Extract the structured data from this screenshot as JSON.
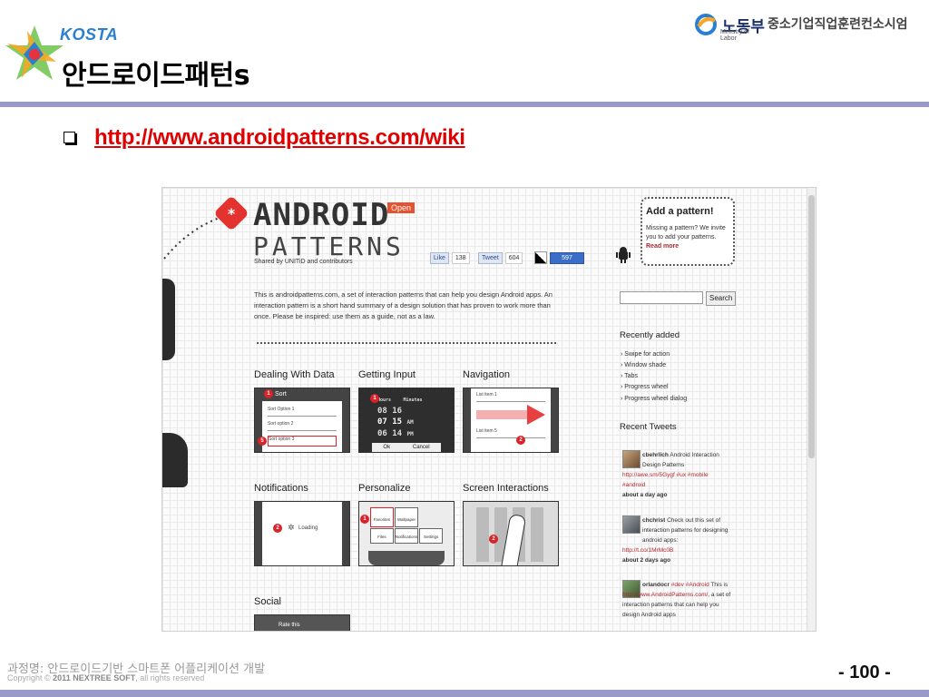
{
  "header": {
    "org_logo_text": "KOSTA",
    "title": "안드로이드패턴s",
    "ministry_name": "노동부",
    "ministry_sub": "Ministry of Labor",
    "consortium": "중소기업직업훈련컨소시엄"
  },
  "link": {
    "url_text": "http://www.androidpatterns.com/wiki"
  },
  "screenshot": {
    "site_title": "ANDROID",
    "site_subtitle": "PATTERNS",
    "open_tag": "Open",
    "shared_by": "Shared by UNITiD and contributors",
    "social": {
      "like_label": "Like",
      "like_count": "138",
      "tweet_label": "Tweet",
      "tweet_count": "604",
      "share_count": "597"
    },
    "description": "This is androidpatterns.com, a set of interaction patterns that can help you design Android apps. An interaction pattern is a short hand summary of a design solution that has proven to work more than once. Please be inspired: use them as a guide, not as a law.",
    "sections": [
      {
        "title": "Dealing With Data",
        "thumb_title": "Sort",
        "rows": [
          "Sort Option 1",
          "Sort option 2",
          "Sort option 3"
        ],
        "badges": [
          "1",
          "5"
        ]
      },
      {
        "title": "Getting Input",
        "labels": [
          "Hours",
          "Minutes",
          "08",
          "16",
          "07",
          "15",
          "AM",
          "06",
          "14",
          "PM",
          "Ok",
          "Cancel"
        ],
        "badges": [
          "1"
        ]
      },
      {
        "title": "Navigation",
        "rows": [
          "List item 1",
          "List item 5"
        ],
        "badges": [
          "2"
        ]
      },
      {
        "title": "Notifications",
        "thumb_text": "Loading",
        "badges": [
          "2"
        ]
      },
      {
        "title": "Personalize",
        "labels": [
          "Favorites",
          "Wallpaper",
          "Files",
          "Notifications",
          "Settings"
        ],
        "badges": [
          "1"
        ]
      },
      {
        "title": "Screen Interactions",
        "badges": [
          "2"
        ]
      },
      {
        "title": "Social",
        "thumb_text": "Rate this"
      }
    ],
    "add_pattern": {
      "title": "Add a pattern!",
      "text": "Missing a pattern? We invite you to add your patterns.",
      "read_more": "Read more"
    },
    "search_button": "Search",
    "recently_added": {
      "heading": "Recently added",
      "items": [
        "Swipe for action",
        "Window shade",
        "Tabs",
        "Progress wheel",
        "Progress wheel dialog"
      ]
    },
    "recent_tweets": {
      "heading": "Recent Tweets",
      "items": [
        {
          "user": "cbehrlich",
          "text": "Android Interaction Design Patterns",
          "link": "http://awe.sm/5Gygf #ux #mobile #android",
          "ago": "about a day ago"
        },
        {
          "user": "chchrist",
          "text": "Check out this set of interaction patterns for designing android apps:",
          "link": "http://t.co/1MrMc0B",
          "ago": "about 2 days ago"
        },
        {
          "user": "orlandocr",
          "text": "This is",
          "tags": "#dev #Android",
          "link": "http://www.AndroidPatterns.com/",
          "text2": ", a set of interaction patterns that can help you design Android apps"
        }
      ]
    }
  },
  "footer": {
    "course": "과정명: 안드로이드기반 스마트폰 어플리케이션 개발",
    "copyright_prefix": "Copyright ©",
    "copyright_company": "2011 NEXTREE SOFT",
    "copyright_suffix": ", all rights reserved",
    "page_number": "- 100 -"
  },
  "colors": {
    "rule": "#9a9ac8",
    "link": "#e00000",
    "kosta": "#2a7fd0",
    "badge": "#d8232a",
    "accent_orange": "#e4522f"
  },
  "icons": [
    "kosta-star-logo",
    "ministry-logo",
    "checkbox-bullet-icon",
    "android-robot-icon",
    "asterisk-badge-icon"
  ]
}
